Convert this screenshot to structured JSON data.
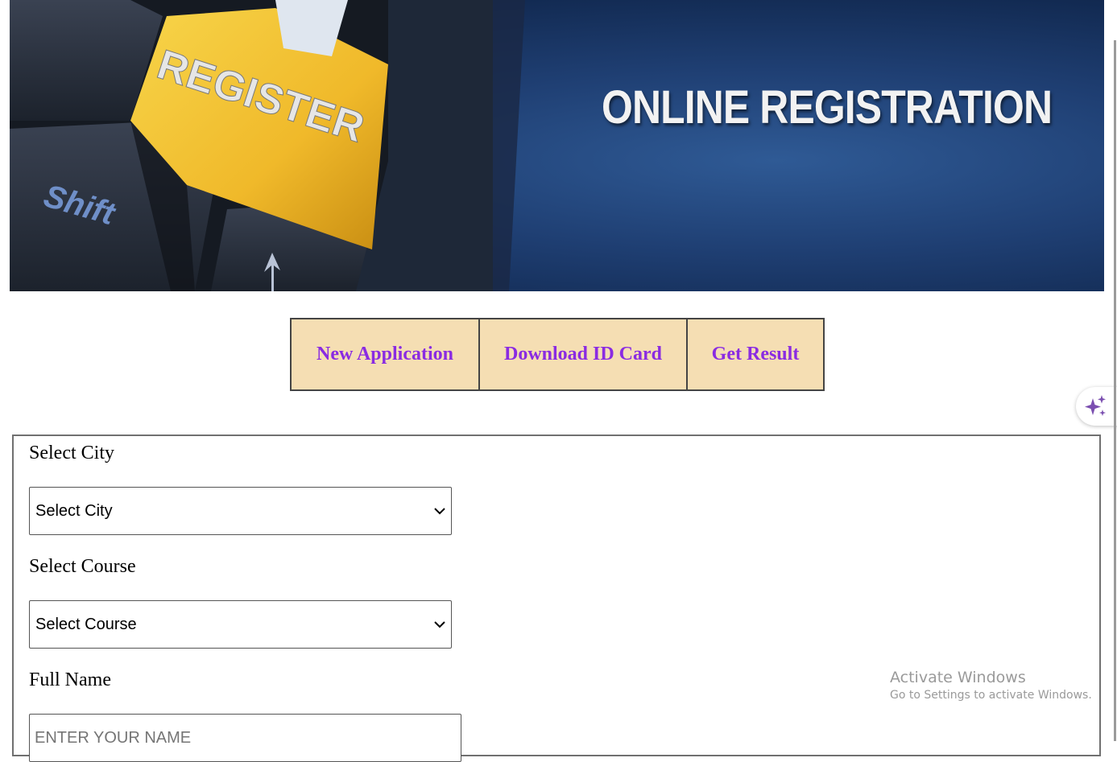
{
  "banner": {
    "title": "ONLINE REGISTRATION",
    "key_label": "REGISTER",
    "shift_label": "Shift"
  },
  "tabs": [
    {
      "label": "New Application"
    },
    {
      "label": "Download ID Card"
    },
    {
      "label": "Get Result"
    }
  ],
  "form": {
    "city_label": "Select City",
    "city_selected": "Select City",
    "course_label": "Select Course",
    "course_selected": "Select Course",
    "name_label": "Full Name",
    "name_placeholder": "ENTER YOUR NAME"
  },
  "watermark": {
    "line1": "Activate Windows",
    "line2": "Go to Settings to activate Windows."
  },
  "icons": {
    "ai_assistant": "sparkle-icon",
    "dropdown": "chevron-down-icon"
  },
  "colors": {
    "tab_bg": "#f5deb3",
    "tab_text": "#8a2be2",
    "banner_blue": "#1f3f73",
    "key_yellow": "#f3c02e"
  }
}
